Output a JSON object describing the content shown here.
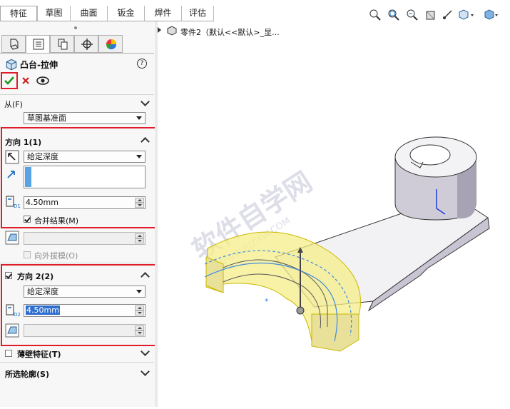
{
  "top_tabs": [
    "特征",
    "草图",
    "曲面",
    "钣金",
    "焊件",
    "评估"
  ],
  "panel_tabs": [
    "feature-manager-icon",
    "property-manager-icon",
    "configuration-manager-icon",
    "dimxpert-icon",
    "display-manager-icon"
  ],
  "feature": {
    "title": "凸台-拉伸",
    "help": "?"
  },
  "from": {
    "label": "从(F)",
    "value": "草图基准面"
  },
  "direction1": {
    "label": "方向 1(1)",
    "end_condition": "给定深度",
    "depth": "4.50mm",
    "merge_label": "合并结果(M)",
    "merge_checked": true,
    "draft_outward_label": "向外拔模(O)"
  },
  "direction2": {
    "label": "方向 2(2)",
    "checked": true,
    "end_condition": "给定深度",
    "depth": "4.50mm"
  },
  "thin_feature": {
    "label": "薄壁特征(T)",
    "checked": false
  },
  "selected_contours": {
    "label": "所选轮廓(S)"
  },
  "tree": {
    "item": "零件2（默认<<默认>_显..."
  },
  "watermark": {
    "main": "软件自学网",
    "sub": "WWW.RJZXW.COM"
  },
  "colors": {
    "accent_red": "#e11c2a",
    "highlight_yellow": "#f6ee8a",
    "check_green": "#1f9a1f",
    "cancel_red": "#d01818",
    "part_grey": "#cfcfd6"
  }
}
